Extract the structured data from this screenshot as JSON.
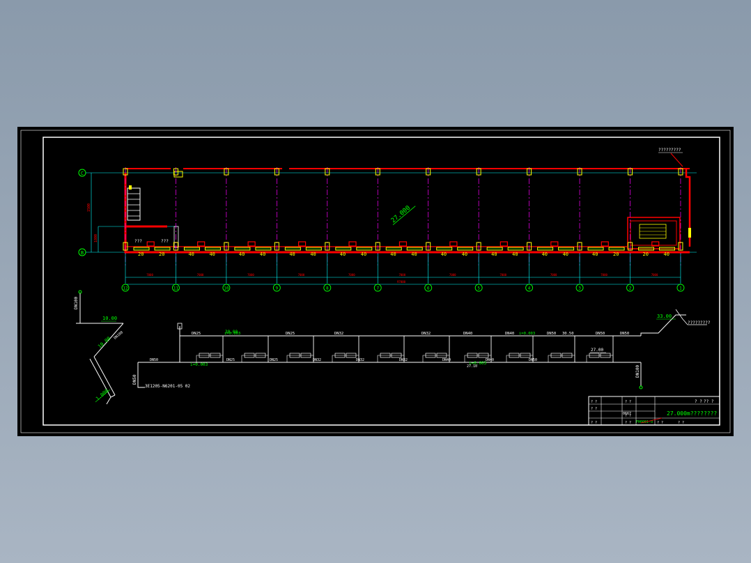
{
  "colors": {
    "background": "#000000",
    "frame": "#ffffff",
    "wall": "#ff0000",
    "axis_grid": "#ff00ff",
    "dimension": "#00ffff",
    "radiator": "#ffff00",
    "green_text": "#00ff00",
    "pipe": "#ffffff"
  },
  "plan": {
    "note_top_right": "?????????",
    "floor_level": "27.000",
    "left_dims": [
      "1500",
      "1800"
    ],
    "small_labels": [
      "???",
      "???"
    ],
    "radiator_counts": [
      "20",
      "20",
      "40",
      "40",
      "40",
      "40",
      "40",
      "40",
      "40",
      "40",
      "40",
      "40",
      "40",
      "40",
      "40",
      "40",
      "40",
      "40",
      "40"
    ],
    "bottom_dims": [
      "7000",
      "7000",
      "7000",
      "7000",
      "7000",
      "7000",
      "7000",
      "7000",
      "7000",
      "7000",
      "7000",
      "7000"
    ],
    "bottom_total": "97000",
    "axis_labels_bottom": [
      "12",
      "11",
      "10",
      "9",
      "8",
      "7",
      "6",
      "5",
      "4",
      "3",
      "2",
      "1"
    ],
    "axis_labels_left": [
      "C",
      "B"
    ]
  },
  "system": {
    "left_riser_label": "DN100",
    "left_level": "10.00",
    "left_diag_label": "DN100",
    "left_diag_level": "10.00",
    "bottom_level": "1.000",
    "main_label": "DN50",
    "supply_label": "DN50",
    "reference": "3E1205-N6201-05 02",
    "top_labels": [
      "DN25",
      "i=0.003",
      "DN25",
      "DN32",
      "DN32",
      "DN40",
      "DN40",
      "i=0.003",
      "DN50",
      "30.50",
      "DN50",
      "DN50"
    ],
    "top_level": "30.00",
    "right_level_top": "33.00",
    "right_note": "?????????",
    "right_riser_label": "DN100",
    "level_27": "27.00",
    "level_27b": "27.10",
    "slope_return": "i=0.003",
    "slope_left": "i=0.003",
    "radiator_boxes": [
      "20",
      "20",
      "40",
      "40",
      "40",
      "40",
      "40",
      "40",
      "40",
      "40",
      "40",
      "40",
      "40",
      "40",
      "40",
      "40",
      "40",
      "40",
      "40",
      "40"
    ],
    "return_labels": [
      "DN25",
      "DN25",
      "DN32",
      "DN32",
      "DN32",
      "DN40",
      "DN40",
      "DN50"
    ]
  },
  "title_block": {
    "row_labels": [
      "? ?",
      "? ?",
      "? ?"
    ],
    "col_labels": [
      "? ?",
      "? ?",
      "? ?"
    ],
    "small_code": "0667",
    "drawing_no": "FH0001-0",
    "scale_labels": [
      "? ?",
      "? ?"
    ],
    "top_right": "? ?",
    "top_right2": "??  ?",
    "top_right3": "?? ?",
    "title": "27.000m????????"
  }
}
